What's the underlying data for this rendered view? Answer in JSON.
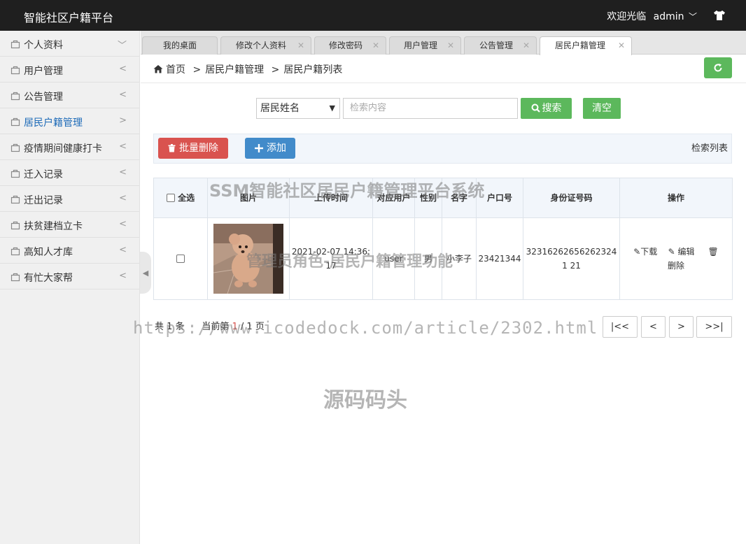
{
  "header": {
    "title": "智能社区户籍平台",
    "welcome": "欢迎光临",
    "username": "admin"
  },
  "sidebar": {
    "items": [
      {
        "label": "个人资料",
        "arrow": "﹀"
      },
      {
        "label": "用户管理",
        "arrow": "<"
      },
      {
        "label": "公告管理",
        "arrow": "<"
      },
      {
        "label": "居民户籍管理",
        "arrow": ">"
      },
      {
        "label": "疫情期间健康打卡",
        "arrow": "<"
      },
      {
        "label": "迁入记录",
        "arrow": "<"
      },
      {
        "label": "迁出记录",
        "arrow": "<"
      },
      {
        "label": "扶贫建档立卡",
        "arrow": "<"
      },
      {
        "label": "高知人才库",
        "arrow": "<"
      },
      {
        "label": "有忙大家帮",
        "arrow": "<"
      }
    ]
  },
  "tabs": [
    {
      "label": "我的桌面"
    },
    {
      "label": "修改个人资料"
    },
    {
      "label": "修改密码"
    },
    {
      "label": "用户管理"
    },
    {
      "label": "公告管理"
    },
    {
      "label": "居民户籍管理"
    }
  ],
  "breadcrumb": {
    "home": "首页",
    "section": "居民户籍管理",
    "page": "居民户籍列表"
  },
  "search": {
    "field": "居民姓名",
    "placeholder": "检索内容",
    "search_label": "搜索",
    "clear_label": "清空"
  },
  "toolbar": {
    "batch_delete": "批量删除",
    "add": "添加",
    "list_title": "检索列表"
  },
  "table": {
    "select_all": "全选",
    "headers": [
      "图片",
      "上传时间",
      "对应用户",
      "性别",
      "名字",
      "户口号",
      "身份证号码",
      "操作"
    ],
    "rows": [
      {
        "upload_time": "2021-02-07 14:36:17",
        "user": "user",
        "gender": "男",
        "name": "小李子",
        "hukou": "23421344",
        "id_number": "323162626562623241 21",
        "download": "下载",
        "edit": "编辑",
        "delete": "删除"
      }
    ]
  },
  "pagination": {
    "total": "共 1 条",
    "current_prefix": "当前第",
    "current": "1",
    "of": "/ 1 页",
    "first": "|<<",
    "prev": "<",
    "next": ">",
    "last": ">>|"
  },
  "watermarks": {
    "title": "SSM智能社区居民户籍管理平台系统",
    "role": "管理员角色-居民户籍管理功能",
    "url": "https://www.icodedock.com/article/2302.html",
    "brand": "源码码头"
  },
  "colors": {
    "topbar": "#1f1f1f",
    "green": "#5cb85c",
    "red": "#d9534f",
    "blue": "#428bca",
    "active_link": "#1e6bb8"
  }
}
